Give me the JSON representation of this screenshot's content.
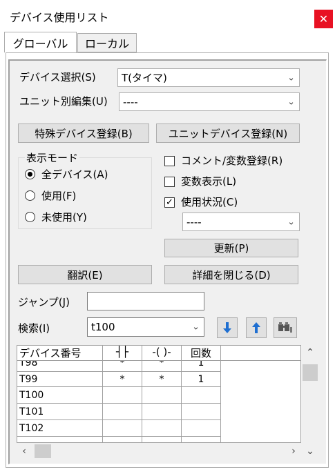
{
  "window": {
    "title": "デバイス使用リスト",
    "close_label": "✕"
  },
  "tabs": [
    {
      "label": "グローバル"
    },
    {
      "label": "ローカル"
    }
  ],
  "device_select": {
    "label": "デバイス選択(S)",
    "value": "T(タイマ)"
  },
  "unit_edit": {
    "label": "ユニット別編集(U)",
    "value": "----"
  },
  "buttons": {
    "special_device": "特殊デバイス登録(B)",
    "unit_device": "ユニットデバイス登録(N)",
    "update": "更新(P)",
    "translate": "翻訳(E)",
    "close_details": "詳細を閉じる(D)"
  },
  "display_mode": {
    "label": "表示モード",
    "options": [
      {
        "label": "全デバイス(A)",
        "selected": true
      },
      {
        "label": "使用(F)",
        "selected": false
      },
      {
        "label": "未使用(Y)",
        "selected": false
      }
    ]
  },
  "checks": [
    {
      "label": "コメント/変数登録(R)",
      "checked": false
    },
    {
      "label": "変数表示(L)",
      "checked": false
    },
    {
      "label": "使用状況(C)",
      "checked": true
    }
  ],
  "usage_combo": {
    "value": "----"
  },
  "jump": {
    "label": "ジャンプ(J)",
    "value": ""
  },
  "search": {
    "label": "検索(I)",
    "value": "t100"
  },
  "table": {
    "headers": [
      "デバイス番号",
      "┤├",
      "-( )-",
      "回数"
    ],
    "rows": [
      [
        "T98",
        "*",
        "*",
        "1"
      ],
      [
        "T99",
        "*",
        "*",
        "1"
      ],
      [
        "T100",
        "",
        "",
        ""
      ],
      [
        "T101",
        "",
        "",
        ""
      ],
      [
        "T102",
        "",
        "",
        ""
      ]
    ]
  },
  "icons": {
    "dropdown": "chevron-down-icon",
    "search_next": "arrow-down-icon",
    "search_prev": "arrow-up-icon",
    "search_options": "binoculars-icon"
  },
  "colors": {
    "close": "#e81123",
    "arrow_blue": "#1f6fd1"
  }
}
